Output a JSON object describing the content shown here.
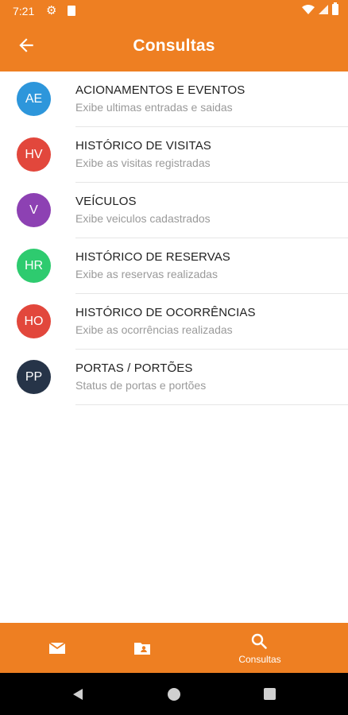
{
  "status_bar": {
    "time": "7:21"
  },
  "header": {
    "title": "Consultas"
  },
  "items": [
    {
      "initials": "AE",
      "color": "#2d96db",
      "title": "ACIONAMENTOS E EVENTOS",
      "subtitle": "Exibe ultimas entradas e saidas"
    },
    {
      "initials": "HV",
      "color": "#e2473c",
      "title": "HISTÓRICO DE VISITAS",
      "subtitle": "Exibe as visitas registradas"
    },
    {
      "initials": "V",
      "color": "#8d41b3",
      "title": "VEÍCULOS",
      "subtitle": "Exibe veiculos cadastrados"
    },
    {
      "initials": "HR",
      "color": "#2ecb6f",
      "title": "HISTÓRICO DE RESERVAS",
      "subtitle": "Exibe as reservas realizadas"
    },
    {
      "initials": "HO",
      "color": "#e2473c",
      "title": "HISTÓRICO DE OCORRÊNCIAS",
      "subtitle": "Exibe as ocorrências realizadas"
    },
    {
      "initials": "PP",
      "color": "#263448",
      "title": "PORTAS / PORTÕES",
      "subtitle": "Status de portas e portões"
    }
  ],
  "bottom_nav": {
    "items": [
      {
        "icon": "mail-icon",
        "label": ""
      },
      {
        "icon": "contact-folder-icon",
        "label": ""
      },
      {
        "icon": "search-icon",
        "label": "Consultas"
      }
    ]
  },
  "theme": {
    "accent": "#ee7f22"
  }
}
